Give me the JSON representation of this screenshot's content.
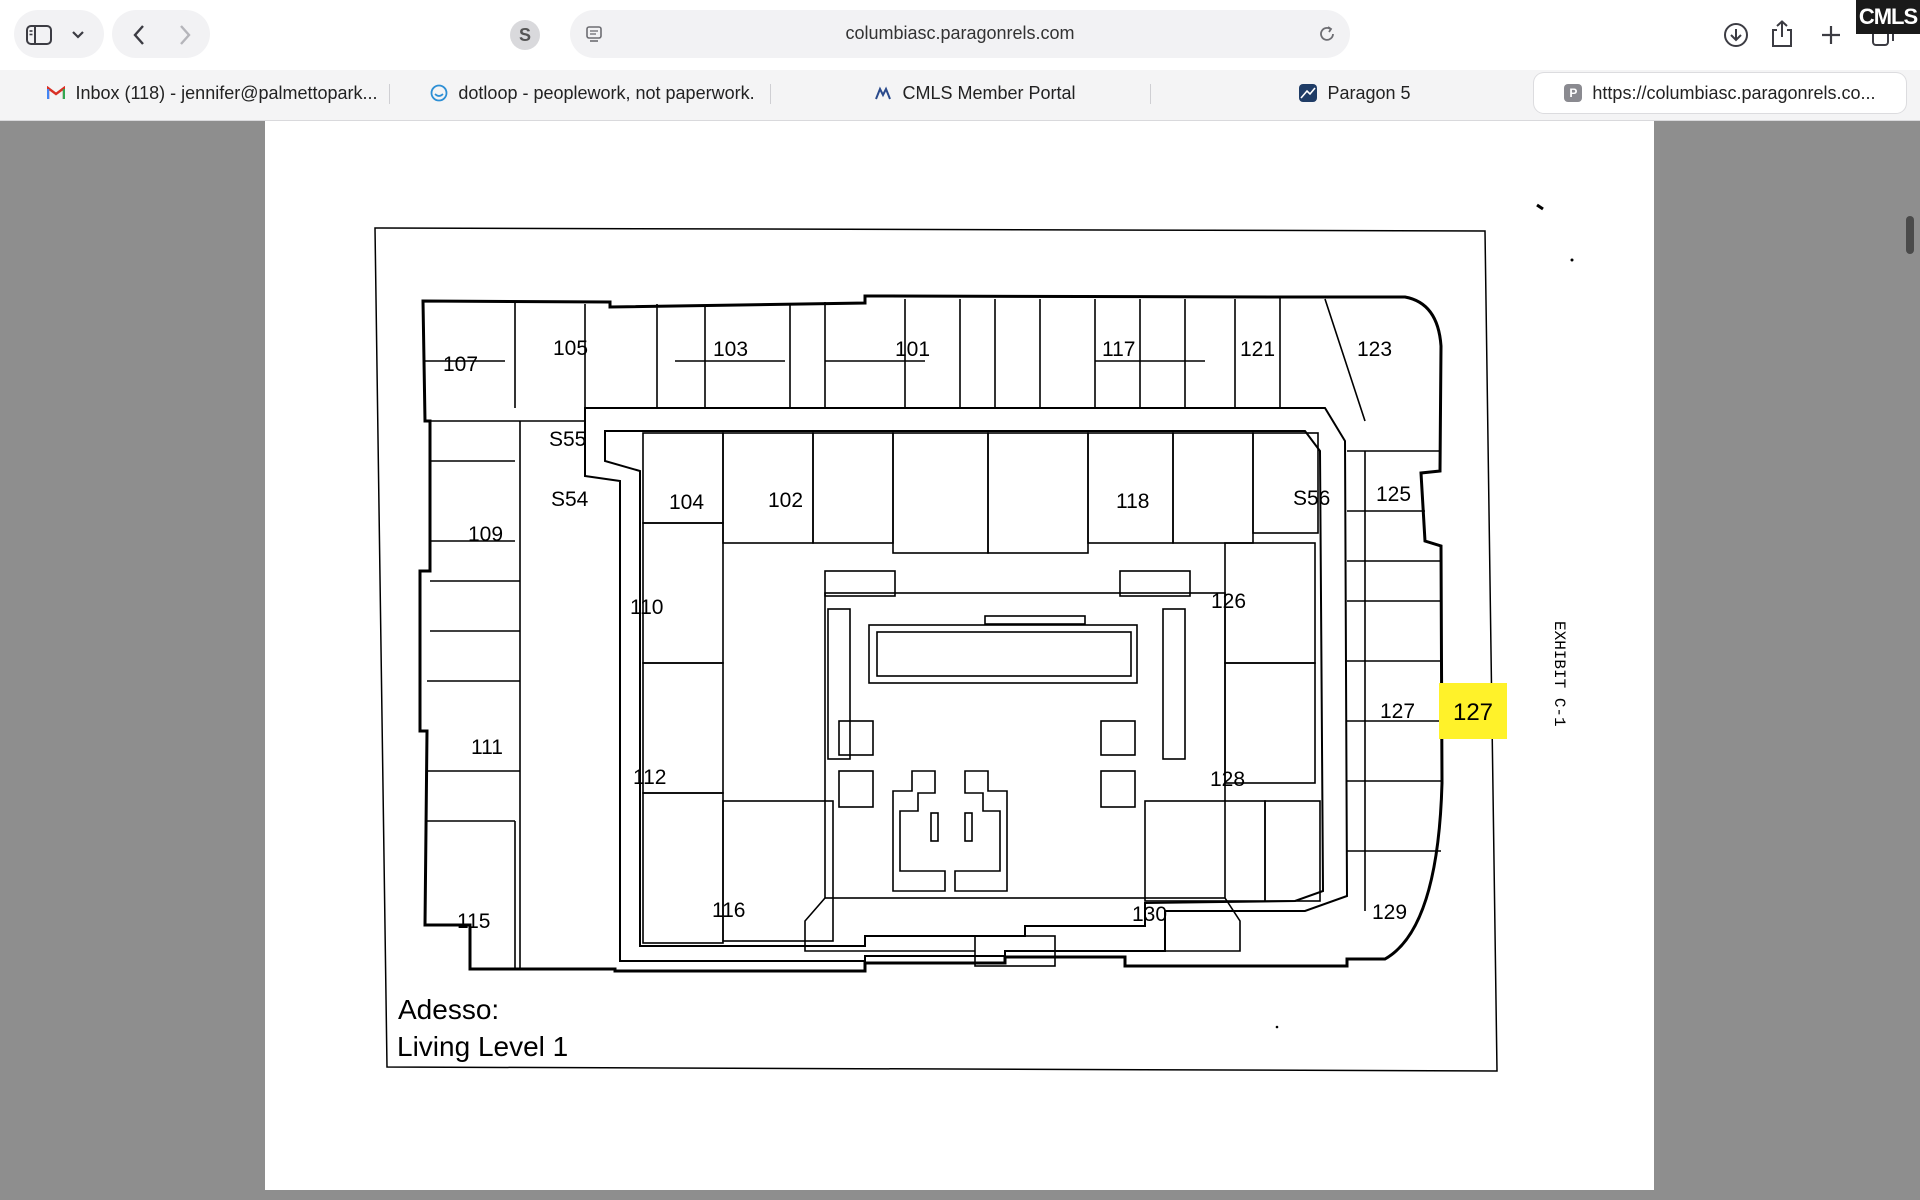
{
  "browser": {
    "address": "columbiasc.paragonrels.com",
    "icons": {
      "sidebar": "sidebar-icon",
      "chevron": "chevron-down-icon",
      "back": "back-arrow-icon",
      "forward": "forward-arrow-icon",
      "extension": "s-extension-icon",
      "page_menu": "page-menu-icon",
      "reload": "reload-icon",
      "download": "download-icon",
      "share": "share-icon",
      "new_tab": "plus-icon",
      "tab_overview": "tab-overview-icon"
    },
    "tabs": [
      {
        "label": "Inbox (118) - jennifer@palmettopark...",
        "icon": "gmail-icon",
        "active": false
      },
      {
        "label": "dotloop - peoplework, not paperwork.",
        "icon": "dotloop-icon",
        "active": false
      },
      {
        "label": "CMLS Member Portal",
        "icon": "cmls-icon",
        "active": false
      },
      {
        "label": "Paragon 5",
        "icon": "paragon-icon",
        "active": false
      },
      {
        "label": "https://columbiasc.paragonrels.co...",
        "icon": "p-icon",
        "active": true
      }
    ],
    "overlay_logo": "CMLS"
  },
  "document": {
    "caption_line1": "Adesso:",
    "caption_line2": "Living Level 1",
    "exhibit": "EXHIBIT C-1",
    "highlight_label": "127",
    "highlight_color": "#fff22a",
    "room_labels": [
      "107",
      "105",
      "103",
      "101",
      "117",
      "121",
      "123",
      "S55",
      "S54",
      "104",
      "102",
      "118",
      "S56",
      "125",
      "109",
      "110",
      "126",
      "127",
      "111",
      "112",
      "128",
      "115",
      "116",
      "130",
      "129"
    ]
  }
}
